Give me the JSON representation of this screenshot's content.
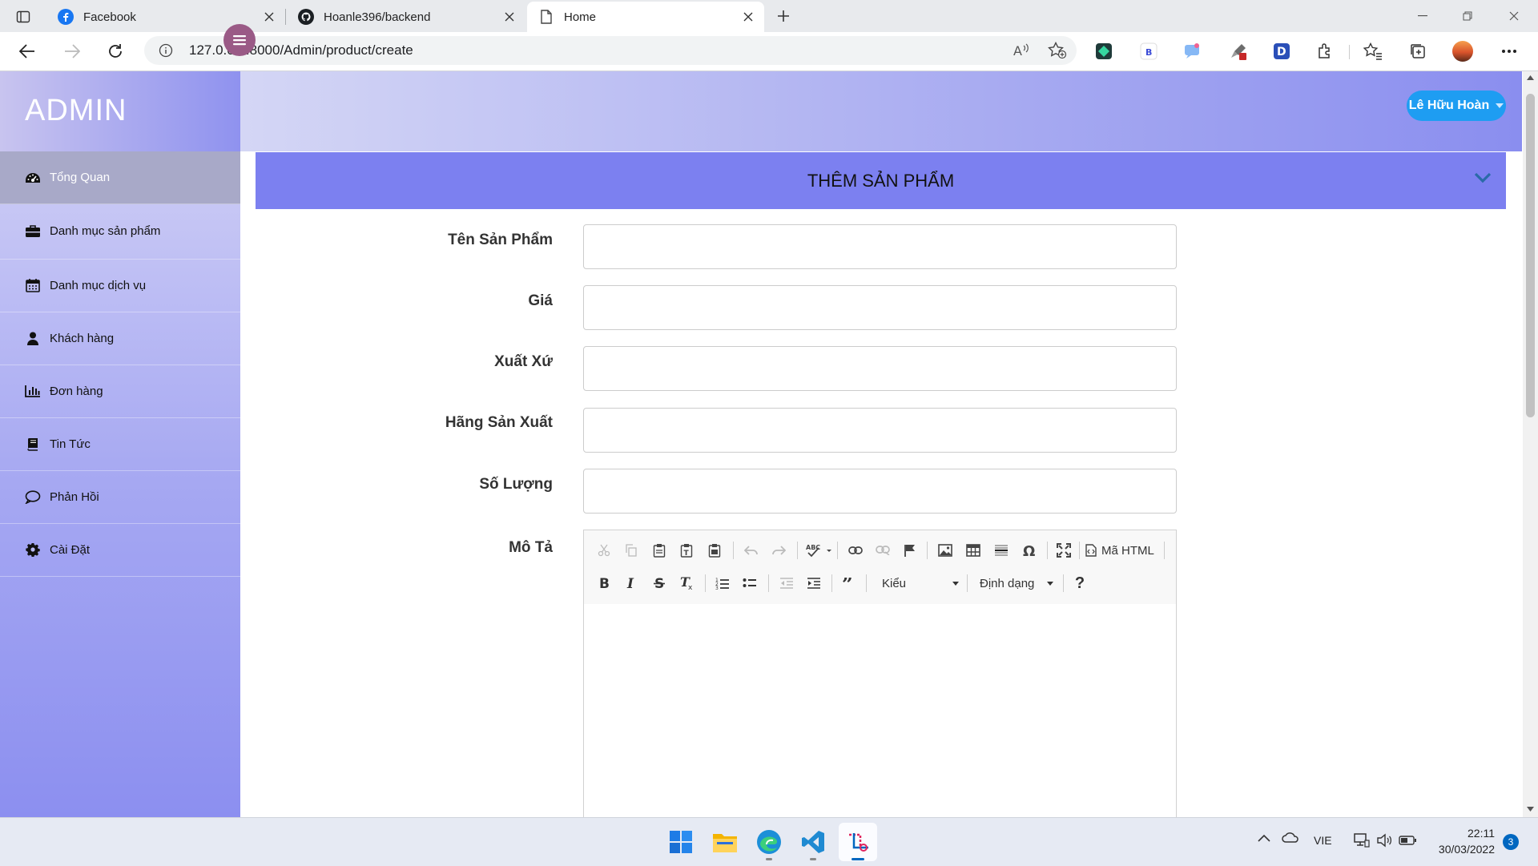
{
  "browser": {
    "tabs": [
      {
        "title": "Facebook",
        "icon": "facebook-icon",
        "active": false
      },
      {
        "title": "Hoanle396/backend",
        "icon": "github-icon",
        "active": false
      },
      {
        "title": "Home",
        "icon": "page-icon",
        "active": true
      }
    ],
    "url": "127.0.0.1:8000/Admin/product/create"
  },
  "sidebar": {
    "brand": "ADMIN",
    "items": [
      {
        "label": "Tổng Quan",
        "icon": "dashboard-icon",
        "active": true
      },
      {
        "label": "Danh mục sản phẩm",
        "icon": "briefcase-icon"
      },
      {
        "label": "Danh mục dịch vụ",
        "icon": "calendar-icon"
      },
      {
        "label": "Khách hàng",
        "icon": "user-icon"
      },
      {
        "label": "Đơn hàng",
        "icon": "bar-chart-icon"
      },
      {
        "label": "Tin Tức",
        "icon": "book-icon"
      },
      {
        "label": "Phản Hồi",
        "icon": "comment-icon"
      },
      {
        "label": "Cài Đặt",
        "icon": "gear-icon"
      }
    ]
  },
  "header": {
    "user_name": "Lê Hữu Hoàn"
  },
  "panel": {
    "title": "THÊM SẢN PHẨM"
  },
  "form": {
    "fields": [
      {
        "label": "Tên Sản Phẩm",
        "value": ""
      },
      {
        "label": "Giá",
        "value": ""
      },
      {
        "label": "Xuất Xứ",
        "value": ""
      },
      {
        "label": "Hãng Sản Xuất",
        "value": ""
      },
      {
        "label": "Số Lượng",
        "value": ""
      }
    ],
    "description_label": "Mô Tả",
    "editor": {
      "source_label": "Mã HTML",
      "styles_label": "Kiểu",
      "format_label": "Định dạng",
      "help_label": "?"
    }
  },
  "taskbar": {
    "apps": [
      "windows-start-icon",
      "file-explorer-icon",
      "edge-icon",
      "vscode-icon",
      "snipping-tool-icon"
    ],
    "language": "VIE",
    "time": "22:11",
    "date": "30/03/2022",
    "notification_count": "3"
  }
}
